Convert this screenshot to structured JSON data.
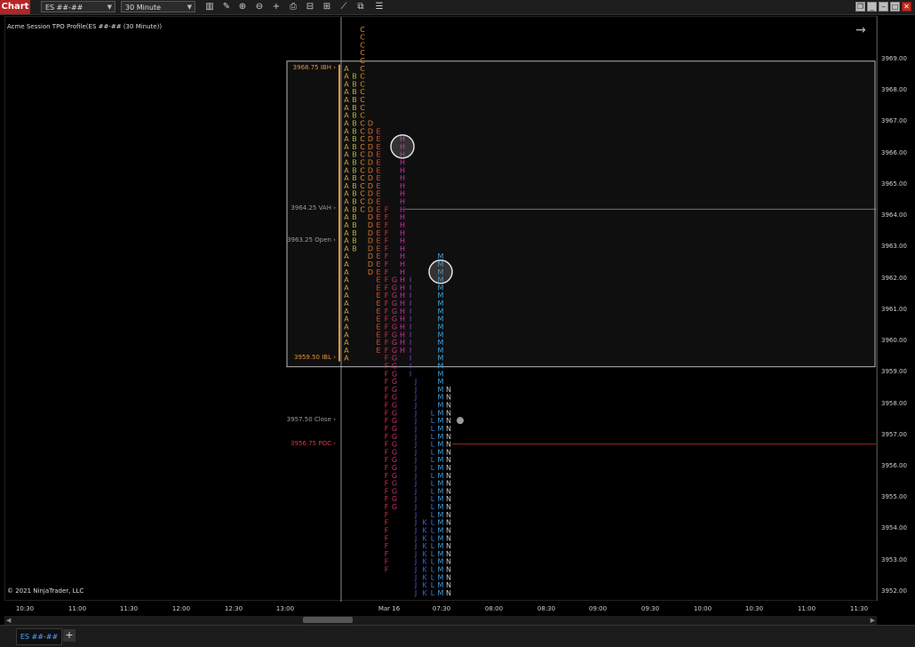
{
  "toolbar": {
    "chart_tab_label": "Chart",
    "instrument_value": "ES ##-##",
    "interval_value": "30 Minute",
    "tools": [
      "bar-type-icon",
      "pencil-icon",
      "zoom-in-icon",
      "zoom-out-icon",
      "crosshair-icon",
      "data-box-icon",
      "properties-icon",
      "indicators-icon",
      "strategies-icon",
      "drawing-tools-icon",
      "list-icon"
    ],
    "window_buttons": [
      "restore",
      "minimize",
      "maximize",
      "close"
    ]
  },
  "chart": {
    "title": "Acme Session TPO Profile(ES ##-## (30 Minute))",
    "copyright": "© 2021 NinjaTrader, LLC",
    "f_button_label": "F",
    "colors": {
      "ib_box": "#b8b8b8",
      "ib_text": "#e0933a",
      "vah_text": "#9c9c9c",
      "poc_text": "#e03535",
      "poc_line": "#a82020",
      "vah_line": "#6a6a6a"
    },
    "levels": [
      {
        "label": "3968.75 IBH",
        "price": 3968.75,
        "color": "#e0933a"
      },
      {
        "label": "3964.25 VAH",
        "price": 3964.25,
        "color": "#9c9c9c"
      },
      {
        "label": "3963.25 Open",
        "price": 3963.25,
        "color": "#9c9c9c"
      },
      {
        "label": "3959.50 IBL",
        "price": 3959.5,
        "color": "#e0933a"
      },
      {
        "label": "3957.50 Close",
        "price": 3957.5,
        "color": "#9c9c9c"
      },
      {
        "label": "3956.75 POC",
        "price": 3956.75,
        "color": "#e03535"
      }
    ],
    "ib_high": 3968.75,
    "ib_low": 3959.5,
    "vah": 3964.25,
    "poc": 3956.75,
    "close": 3957.5,
    "tpo_columns": [
      {
        "letter": "A",
        "color": "#c8a038",
        "top": 3968.75,
        "bottom": 3959.5
      },
      {
        "letter": "B",
        "color": "#b5b040",
        "top": 3968.5,
        "bottom": 3963.0
      },
      {
        "letter": "C",
        "color": "#e0902e",
        "top": 3970.0,
        "bottom": 3964.25
      },
      {
        "letter": "D",
        "color": "#e07a24",
        "top": 3967.0,
        "bottom": 3962.25
      },
      {
        "letter": "E",
        "color": "#e05232",
        "top": 3966.75,
        "bottom": 3959.75
      },
      {
        "letter": "F",
        "color": "#d8304a",
        "top": 3964.25,
        "bottom": 3952.75
      },
      {
        "letter": "G",
        "color": "#d03070",
        "top": 3962.0,
        "bottom": 3954.75
      },
      {
        "letter": "H",
        "color": "#d030b0",
        "top": 3966.5,
        "bottom": 3959.75
      },
      {
        "letter": "I",
        "color": "#8c40d0",
        "top": 3962.0,
        "bottom": 3959.0
      },
      {
        "letter": "J",
        "color": "#6050d0",
        "top": 3958.75,
        "bottom": 3952.0
      },
      {
        "letter": "K",
        "color": "#4060d8",
        "top": 3954.25,
        "bottom": 3952.0
      },
      {
        "letter": "L",
        "color": "#4080e0",
        "top": 3957.75,
        "bottom": 3952.0
      },
      {
        "letter": "M",
        "color": "#40a0e0",
        "top": 3962.75,
        "bottom": 3952.0
      },
      {
        "letter": "N",
        "color": "#c8c8c8",
        "top": 3958.5,
        "bottom": 3952.0
      }
    ],
    "highlights": [
      {
        "letter": "H",
        "price": 3966.25
      },
      {
        "letter": "M",
        "price": 3962.25
      }
    ]
  },
  "y_axis": {
    "ticks": [
      "3969.00",
      "3968.00",
      "3967.00",
      "3966.00",
      "3965.00",
      "3964.00",
      "3963.00",
      "3962.00",
      "3961.00",
      "3960.00",
      "3959.00",
      "3958.00",
      "3957.00",
      "3956.00",
      "3955.00",
      "3954.00",
      "3953.00",
      "3952.00"
    ]
  },
  "x_axis": {
    "ticks": [
      "10:30",
      "11:00",
      "11:30",
      "12:00",
      "12:30",
      "13:00",
      "Mar 16",
      "07:30",
      "08:00",
      "08:30",
      "09:00",
      "09:30",
      "10:00",
      "10:30",
      "11:00",
      "11:30"
    ]
  },
  "bottom": {
    "instrument_tab": "ES ##-##",
    "add_tab": "+"
  }
}
